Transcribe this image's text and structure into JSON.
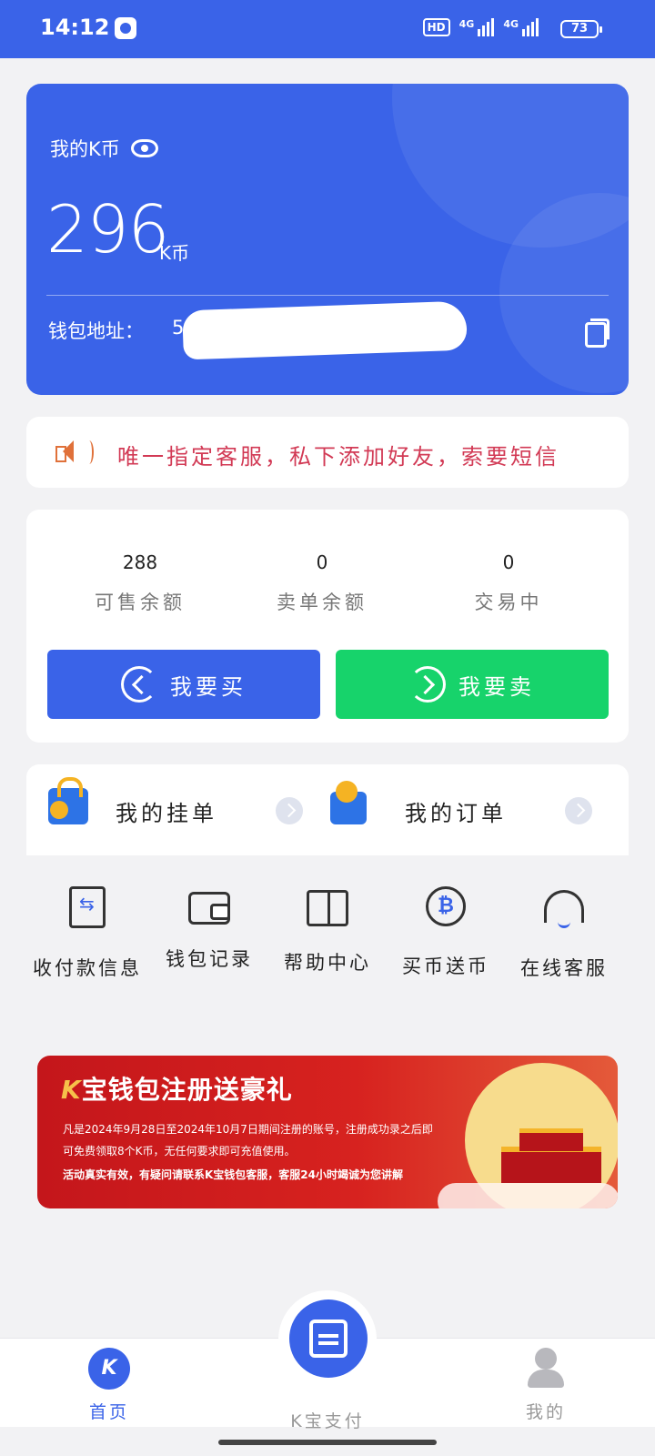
{
  "status_bar": {
    "time": "14:12",
    "hd": "HD",
    "network_1": "4G",
    "network_2": "4G",
    "battery": "73"
  },
  "balance_card": {
    "label": "我的K币",
    "amount": "296",
    "unit": "K币",
    "address_label": "钱包地址：",
    "address_value": "5",
    "icons": [
      "eye-icon",
      "copy-icon"
    ]
  },
  "notice": {
    "text": "唯一指定客服，私下添加好友，索要短信"
  },
  "stats": [
    {
      "value": "288",
      "label": "可售余额"
    },
    {
      "value": "0",
      "label": "卖单余额"
    },
    {
      "value": "0",
      "label": "交易中"
    }
  ],
  "actions": {
    "buy_label": "我要买",
    "sell_label": "我要卖"
  },
  "orders": {
    "my_listings": "我的挂单",
    "my_orders": "我的订单"
  },
  "quick_menu": [
    {
      "label": "收付款信息",
      "icon": "payment-info-icon"
    },
    {
      "label": "钱包记录",
      "icon": "wallet-icon"
    },
    {
      "label": "帮助中心",
      "icon": "help-book-icon"
    },
    {
      "label": "买币送币",
      "icon": "bitcoin-icon"
    },
    {
      "label": "在线客服",
      "icon": "headset-icon"
    }
  ],
  "banner": {
    "brand": "K",
    "title": "宝钱包注册送豪礼",
    "line1": "凡是2024年9月28日至2024年10月7日期间注册的账号，注册成功录之后即",
    "line2": "可免费领取8个K币，无任何要求即可充值使用。",
    "line3": "活动真实有效，有疑问请联系K宝钱包客服，客服24小时竭诚为您讲解"
  },
  "bottom_nav": {
    "home": "首页",
    "pay": "K宝支付",
    "mine": "我的",
    "home_icon_text": "K"
  },
  "colors": {
    "primary": "#3a63e8",
    "sell_green": "#17d36b",
    "notice_red": "#d23a55"
  }
}
